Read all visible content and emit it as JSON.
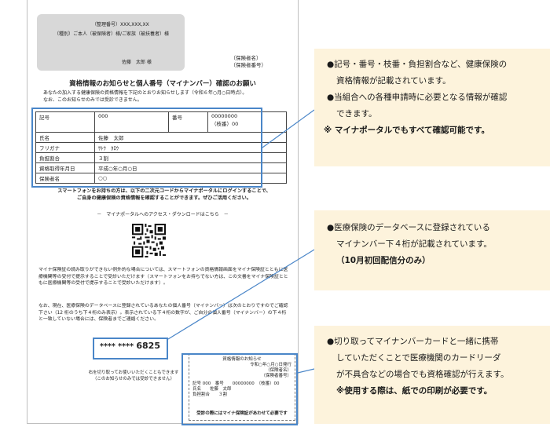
{
  "document": {
    "address": {
      "line1": "（整理番号）XXX,XXX,XX",
      "line2": "（種別）ご本人（被保険者）様/ご家族（被扶養者）様",
      "line3": "佐藤　太郎 様"
    },
    "insurer_line1": "（保険者名）",
    "insurer_line2": "（保険者番号）",
    "title": "資格情報のお知らせと個人番号（マイナンバー）確認のお願い",
    "intro_line1": "あなたの加入する健康保険の資格情報を下記のとおりお知らせします（令和６年○月○日時点）。",
    "intro_line2": "なお、このお知らせのみでは受診できません。",
    "table": {
      "kigo_label": "記号",
      "kigo_value": "000",
      "bango_label": "番号",
      "bango_value": "00000000",
      "edaban_value": "（枝番）00",
      "name_label": "氏名",
      "name_value": "佐藤　太郎",
      "kana_label": "フリガナ",
      "kana_value": "ｻﾄｳ　ﾀﾛｳ",
      "ratio_label": "負担割合",
      "ratio_value": "３割",
      "date_label": "資格取得年月日",
      "date_value": "平成○年○月○日",
      "insurer_label": "保険者名",
      "insurer_value": "○○"
    },
    "qr_lead_line1": "スマートフォンをお持ちの方は、以下の二次元コードからマイナポータルにログインすることで、",
    "qr_lead_line2": "ご自身の健康保険の資格情報を確認することができます。ぜひご活用ください。",
    "portal_line": "－　マイナポータルへのアクセス・ダウンロードはこちら　－",
    "para1": "マイナ保険証の読み取りができない例外的な場合については、スマートフォンの資格情報画面をマイナ保険証とともに医療機関等の受付で提示することで受診いただけます（スマートフォンをお持ちでない方は、この文書をマイナ保険証とともに医療機関等の受付で提示することで受診いただけます）。",
    "para2": "なお、現在、医療保険のデータベースに登録されているあなたの個人番号（マイナンバー）は次のとおりですのでご確認下さい（12 桁のうち下４桁のみ表示）。表示されている下４桁の数字が、ご自分の個人番号（マイナンバー）の下４桁と一致していない場合には、保険者までご連絡ください。",
    "mynumber_mask": "**** ****",
    "mynumber_last4": "6825",
    "cut_note_line1": "右を切り取ってお使いいただくこともできます",
    "cut_note_line2": "（このお知らせのみでは受診できません）",
    "card": {
      "title": "資格情報のお知らせ",
      "issued": "令和○年○月○日発行",
      "insurer_name": "（保険者名）",
      "insurer_number": "（保険者番号）",
      "kigo_line": "記号 000　番号　　00000000　（枝番）00",
      "name_line": "氏名　　佐藤　太郎",
      "ratio_line": "負担割合　　３割",
      "footer": "受診の際にはマイナ保険証があわせて必要です"
    }
  },
  "callouts": [
    {
      "bullet1_line1": "●記号・番号・枝番・負担割合など、健康保険の",
      "bullet1_line2": "資格情報が記載されています。",
      "bullet2_line1": "●当組合への各種申請時に必要となる情報が確認",
      "bullet2_line2": "できます。",
      "note": "※ マイナポータルでもすべて確認可能です。"
    },
    {
      "bullet1_line1": "●医療保険のデータベースに登録されている",
      "bullet1_line2": "マイナンバー下４桁が記載されています。",
      "note": "（10月初回配信分のみ）"
    },
    {
      "bullet1_line1": "●切り取ってマイナンバーカードと一緒に携帯",
      "bullet1_line2": "していただくことで医療機関のカードリーダ",
      "bullet1_line3": "が不具合などの場合でも資格確認が行えます。",
      "note": "※使用する際は、紙での印刷が必要です。"
    }
  ],
  "colors": {
    "highlight": "#4a86c8",
    "callout_bg": "#fdf3dc",
    "address_bg": "#d8d8d8"
  }
}
